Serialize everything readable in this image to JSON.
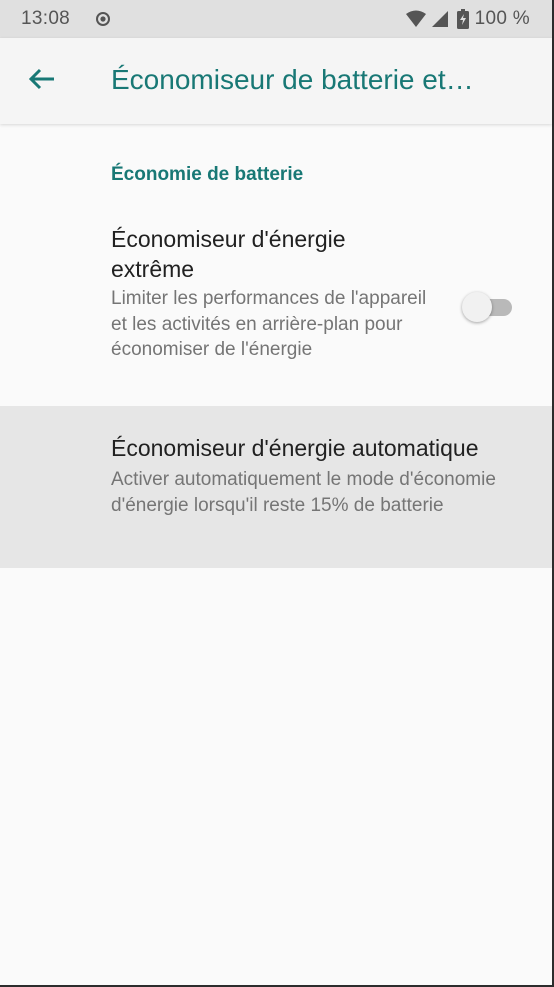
{
  "status_bar": {
    "time": "13:08",
    "battery_percent": "100 %",
    "icons": [
      "sync-icon",
      "wifi-icon",
      "signal-icon",
      "battery-charging-icon"
    ]
  },
  "app_bar": {
    "title": "Économiseur de batterie et…",
    "back_icon": "back-arrow-icon"
  },
  "section": {
    "header": "Économie de batterie"
  },
  "preferences": {
    "extreme": {
      "title": "Économiseur d'énergie extrême",
      "summary": "Limiter les performances de l'appareil et les activités en arrière-plan pour économiser de l'énergie",
      "switch_state": "off"
    },
    "auto": {
      "title": "Économiseur d'énergie automatique",
      "summary": "Activer automatiquement le mode d'économie d'énergie lorsqu'il reste 15% de batterie"
    }
  },
  "colors": {
    "accent": "#187875",
    "status_bar_bg": "#e0e0e0",
    "app_bar_bg": "#f5f5f5",
    "background": "#fafafa",
    "highlight_row": "#e6e6e6",
    "primary_text": "#212121",
    "secondary_text": "#757575"
  }
}
